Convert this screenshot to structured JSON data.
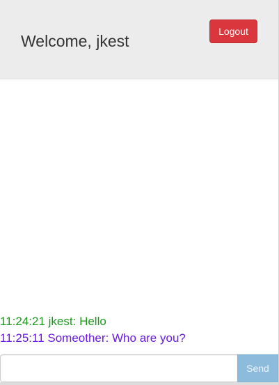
{
  "header": {
    "welcome_text": "Welcome, jkest",
    "logout_label": "Logout"
  },
  "messages": [
    {
      "time": "11:24:21",
      "user": "jkest",
      "text": "Hello",
      "color": "#1a9a1a"
    },
    {
      "time": "11:25:11",
      "user": "Someother",
      "text": "Who are you?",
      "color": "#6a1ae6"
    }
  ],
  "composer": {
    "input_value": "",
    "input_placeholder": "",
    "send_label": "Send"
  },
  "colors": {
    "header_bg": "#ececec",
    "logout_bg": "#d9363e",
    "send_bg": "#8dbbdc"
  }
}
